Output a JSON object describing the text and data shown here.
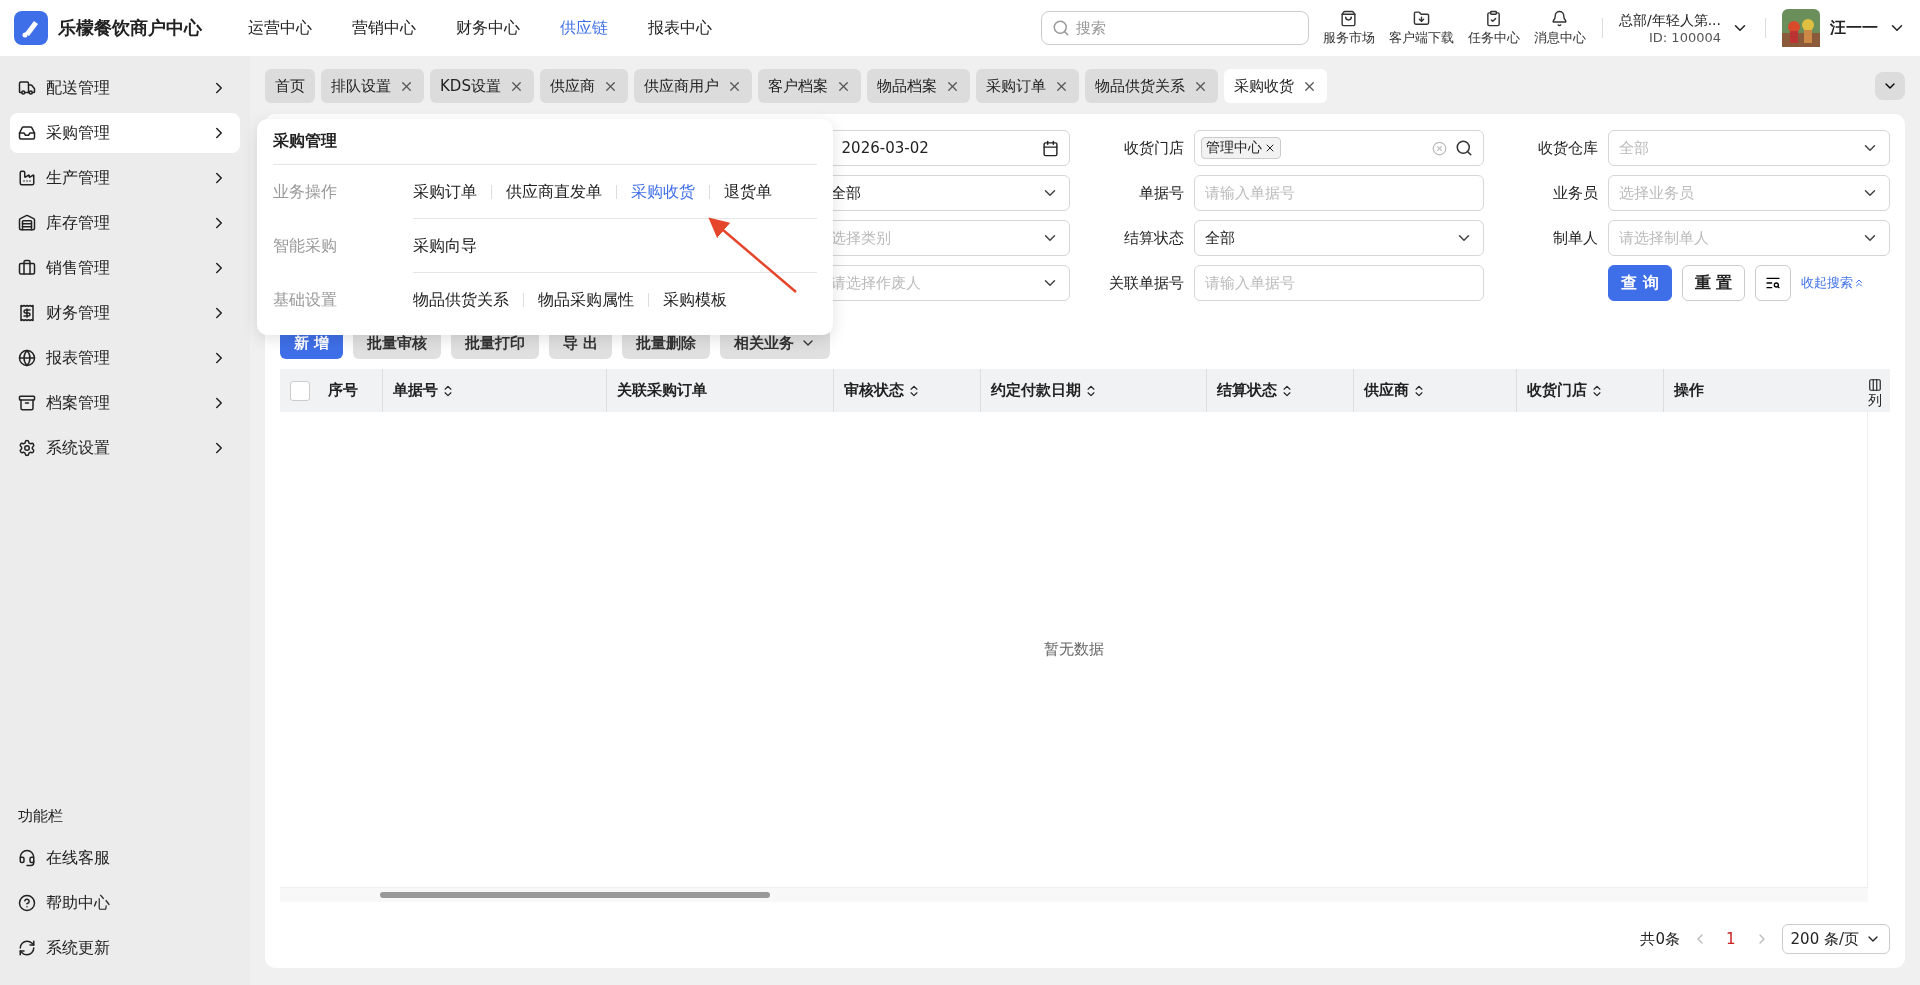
{
  "brand": {
    "name": "乐檬餐饮商户中心"
  },
  "nav": [
    {
      "label": "运营中心",
      "selected": false
    },
    {
      "label": "营销中心",
      "selected": false
    },
    {
      "label": "财务中心",
      "selected": false
    },
    {
      "label": "供应链",
      "selected": true
    },
    {
      "label": "报表中心",
      "selected": false
    }
  ],
  "search": {
    "placeholder": "搜索"
  },
  "shortcuts": [
    {
      "label": "服务市场"
    },
    {
      "label": "客户端下载"
    },
    {
      "label": "任务中心"
    },
    {
      "label": "消息中心"
    }
  ],
  "account": {
    "org": "总部/年轻人第...",
    "id": "ID: 100004",
    "user": "汪一一"
  },
  "sidebar": {
    "items": [
      {
        "label": "配送管理",
        "selected": false
      },
      {
        "label": "采购管理",
        "selected": true
      },
      {
        "label": "生产管理",
        "selected": false
      },
      {
        "label": "库存管理",
        "selected": false
      },
      {
        "label": "销售管理",
        "selected": false
      },
      {
        "label": "财务管理",
        "selected": false
      },
      {
        "label": "报表管理",
        "selected": false
      },
      {
        "label": "档案管理",
        "selected": false
      },
      {
        "label": "系统设置",
        "selected": false
      }
    ],
    "footer_title": "功能栏",
    "footer_items": [
      {
        "label": "在线客服"
      },
      {
        "label": "帮助中心"
      },
      {
        "label": "系统更新"
      }
    ]
  },
  "tabs": [
    {
      "label": "首页",
      "selected": false,
      "closable": false
    },
    {
      "label": "排队设置",
      "selected": false,
      "closable": true
    },
    {
      "label": "KDS设置",
      "selected": false,
      "closable": true
    },
    {
      "label": "供应商",
      "selected": false,
      "closable": true
    },
    {
      "label": "供应商用户",
      "selected": false,
      "closable": true
    },
    {
      "label": "客户档案",
      "selected": false,
      "closable": true
    },
    {
      "label": "物品档案",
      "selected": false,
      "closable": true
    },
    {
      "label": "采购订单",
      "selected": false,
      "closable": true
    },
    {
      "label": "物品供货关系",
      "selected": false,
      "closable": true
    },
    {
      "label": "采购收货",
      "selected": true,
      "closable": true
    }
  ],
  "filters": [
    {
      "kind": "date",
      "value": "2026-03-02"
    },
    {
      "kind": "store",
      "label": "收货门店",
      "tag": "管理中心"
    },
    {
      "kind": "select",
      "label": "收货仓库",
      "placeholder": "全部"
    },
    {
      "kind": "select",
      "value": "全部"
    },
    {
      "kind": "input",
      "label": "单据号",
      "placeholder": "请输入单据号"
    },
    {
      "kind": "select",
      "label": "业务员",
      "placeholder": "选择业务员"
    },
    {
      "kind": "select",
      "placeholder": "选择类别"
    },
    {
      "kind": "select",
      "label": "结算状态",
      "value": "全部"
    },
    {
      "kind": "select",
      "label": "制单人",
      "placeholder": "请选择制单人"
    },
    {
      "kind": "select",
      "placeholder": "请选择作废人"
    },
    {
      "kind": "input",
      "label": "关联单据号",
      "placeholder": "请输入单据号"
    },
    {
      "kind": "actions",
      "query": "查 询",
      "reset": "重 置",
      "collapse": "收起搜索"
    }
  ],
  "toolbar": [
    {
      "label": "新 增",
      "kind": "primary"
    },
    {
      "label": "批量审核",
      "kind": "default"
    },
    {
      "label": "批量打印",
      "kind": "default"
    },
    {
      "label": "导 出",
      "kind": "default"
    },
    {
      "label": "批量删除",
      "kind": "default"
    },
    {
      "label": "相关业务",
      "kind": "dropdown"
    }
  ],
  "table": {
    "columns": [
      {
        "label": "序号",
        "sortable": false
      },
      {
        "label": "单据号",
        "sortable": true
      },
      {
        "label": "关联采购订单",
        "sortable": false
      },
      {
        "label": "审核状态",
        "sortable": true
      },
      {
        "label": "约定付款日期",
        "sortable": true
      },
      {
        "label": "结算状态",
        "sortable": true
      },
      {
        "label": "供应商",
        "sortable": true
      },
      {
        "label": "收货门店",
        "sortable": true
      },
      {
        "label": "操作",
        "sortable": false
      }
    ],
    "select_all": {
      "checked": false
    },
    "column_settings": "列",
    "empty": "暂无数据"
  },
  "pagination": {
    "total": "共0条",
    "pages": [
      {
        "label": "1",
        "selected": true
      }
    ],
    "page_size": "200 条/页"
  },
  "popup": {
    "title": "采购管理",
    "groups": [
      {
        "label": "业务操作",
        "links": [
          {
            "label": "采购订单",
            "selected": false
          },
          {
            "label": "供应商直发单",
            "selected": false
          },
          {
            "label": "采购收货",
            "selected": true
          },
          {
            "label": "退货单",
            "selected": false
          }
        ]
      },
      {
        "label": "智能采购",
        "links": [
          {
            "label": "采购向导",
            "selected": false
          }
        ]
      },
      {
        "label": "基础设置",
        "links": [
          {
            "label": "物品供货关系",
            "selected": false
          },
          {
            "label": "物品采购属性",
            "selected": false
          },
          {
            "label": "采购模板",
            "selected": false
          }
        ]
      }
    ]
  }
}
